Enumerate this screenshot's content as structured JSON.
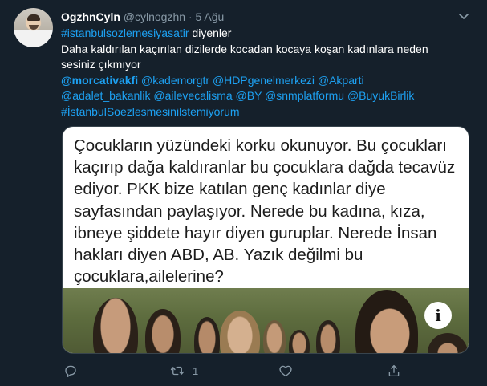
{
  "tweet": {
    "display_name": "OgzhnCyln",
    "handle": "@cylnogzhn",
    "separator": "·",
    "date": "5 Ağu",
    "lines": [
      {
        "parts": [
          {
            "text": "#istanbulsozlemesiyasatir",
            "style": "blue"
          },
          {
            "text": " diyenler",
            "style": "plain"
          }
        ]
      },
      {
        "parts": [
          {
            "text": " Daha kaldırılan kaçırılan dizilerde kocadan kocaya koşan kadınlara neden",
            "style": "plain"
          }
        ]
      },
      {
        "parts": [
          {
            "text": "sesiniz çıkmıyor",
            "style": "plain"
          }
        ]
      },
      {
        "parts": [
          {
            "text": "@morcativakfi",
            "style": "blue-bold"
          },
          {
            "text": " @kademorgtr @HDPgenelmerkezi @Akparti",
            "style": "blue"
          }
        ]
      },
      {
        "parts": [
          {
            "text": "@adalet_bakanlik @ailevecalisma @BY @snmplatformu @BuyukBirlik",
            "style": "blue"
          }
        ]
      },
      {
        "parts": [
          {
            "text": "#İstanbulSoezlesmesinilstemiyorum",
            "style": "blue"
          }
        ]
      }
    ]
  },
  "card": {
    "lines": [
      "Çocukların yüzündeki korku okunuyor. Bu çocukları",
      "kaçırıp dağa kaldıranlar bu çocuklara dağda tecavüz",
      "ediyor. PKK bize katılan genç kadınlar diye",
      "sayfasından paylaşıyor. Nerede bu kadına, kıza,",
      "ibneye şiddete hayır diyen guruplar. Nerede İnsan",
      "hakları diyen ABD, AB. Yazık değilmi bu",
      "çocuklara,ailelerine?"
    ],
    "info_label": "i"
  },
  "actions": {
    "reply_icon": "reply-icon",
    "retweet_icon": "retweet-icon",
    "retweet_count": "1",
    "like_icon": "heart-icon",
    "share_icon": "share-icon"
  },
  "colors": {
    "background": "#15202b",
    "link": "#1da1f2",
    "muted": "#8899a6",
    "card_border": "#38444d"
  }
}
